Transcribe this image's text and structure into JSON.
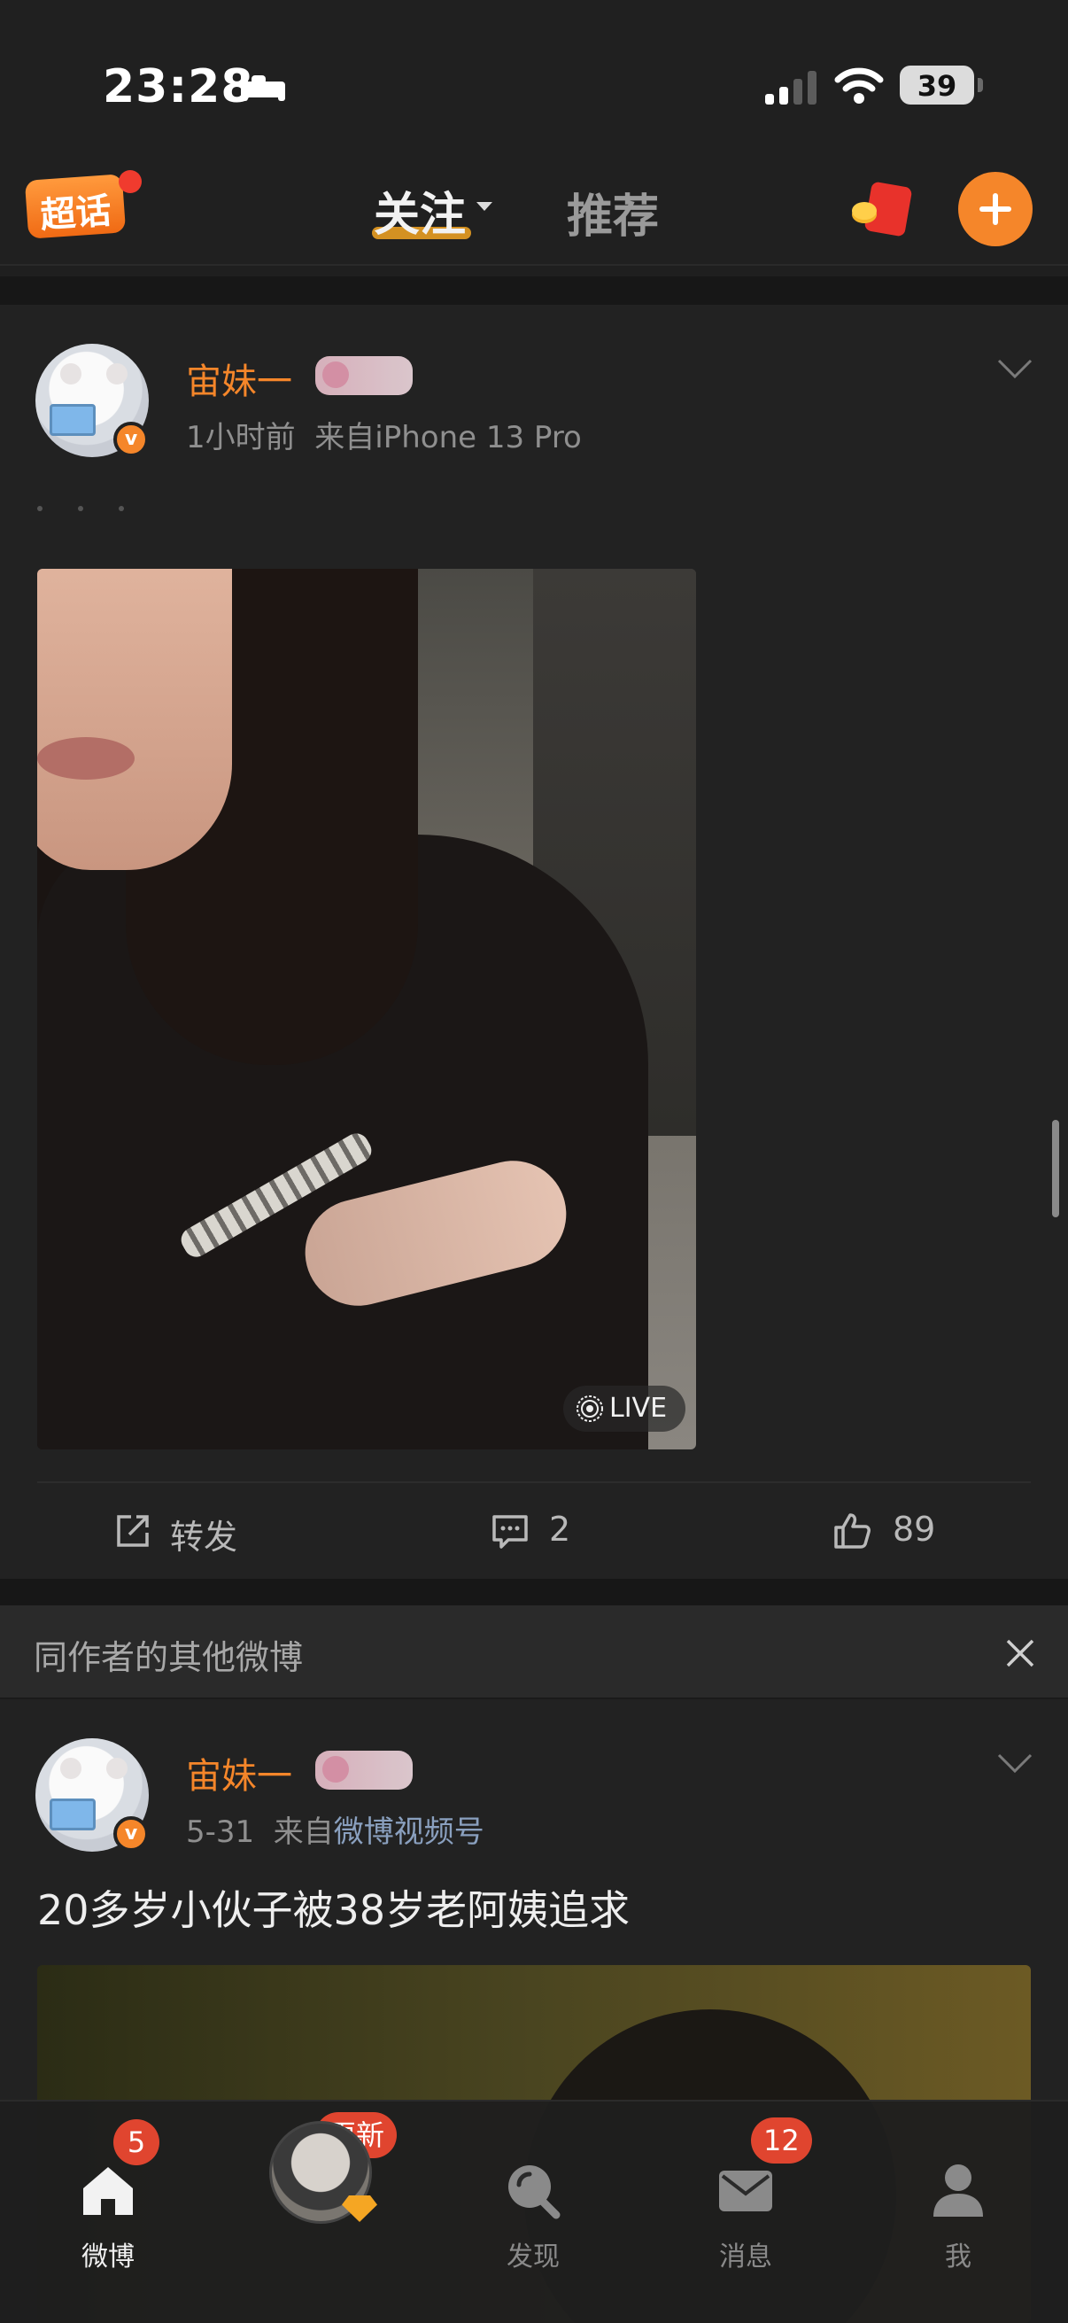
{
  "status_bar": {
    "time": "23:28",
    "battery": "39"
  },
  "top_nav": {
    "logo_label": "超话",
    "tabs": [
      {
        "label": "关注",
        "active": true
      },
      {
        "label": "推荐",
        "active": false
      }
    ]
  },
  "posts": [
    {
      "author": "宙妹一",
      "time": "1小时前",
      "source_prefix": "来自",
      "source": "iPhone 13 Pro",
      "media_badge": "LIVE",
      "actions": {
        "repost": "转发",
        "comments": "2",
        "likes": "89"
      }
    },
    {
      "author": "宙妹一",
      "time": "5-31",
      "source_prefix": "来自",
      "source": "微博视频号",
      "text": "20多岁小伙子被38岁老阿姨追求"
    }
  ],
  "related": {
    "title": "同作者的其他微博"
  },
  "tabbar": {
    "items": [
      {
        "label": "微博",
        "badge": "5",
        "icon": "home-icon"
      },
      {
        "label": "",
        "badge": "更新",
        "icon": "avatar"
      },
      {
        "label": "发现",
        "badge": "",
        "icon": "discover-icon"
      },
      {
        "label": "消息",
        "badge": "12",
        "icon": "message-icon"
      },
      {
        "label": "我",
        "badge": "",
        "icon": "profile-icon"
      }
    ]
  },
  "colors": {
    "accent": "#f5862a",
    "badge": "#e0452f",
    "background": "#1f1f1f"
  }
}
